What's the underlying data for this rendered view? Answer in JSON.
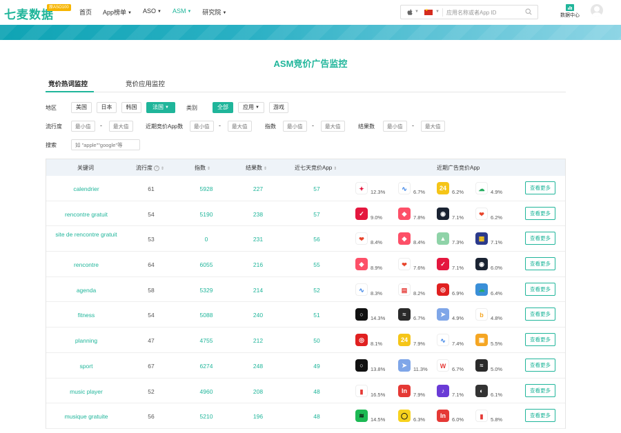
{
  "logo": {
    "text": "七麦数据",
    "badge": "原ASO100"
  },
  "nav": {
    "items": [
      {
        "label": "首页",
        "caret": false
      },
      {
        "label": "App榜单",
        "caret": true
      },
      {
        "label": "ASO",
        "caret": true
      },
      {
        "label": "ASM",
        "caret": true,
        "active": true
      },
      {
        "label": "研究院",
        "caret": true
      }
    ]
  },
  "search": {
    "placeholder": "应用名称或者App ID"
  },
  "header": {
    "data_center": "数据中心"
  },
  "page": {
    "title": "ASM竞价广告监控"
  },
  "tabs": [
    {
      "label": "竞价热词监控",
      "active": true
    },
    {
      "label": "竞价应用监控",
      "active": false
    }
  ],
  "filters": {
    "region_label": "地区",
    "regions": [
      "美国",
      "日本",
      "韩国",
      "法国"
    ],
    "region_selected": "法国",
    "category_label": "类别",
    "categories": [
      "全部",
      "应用",
      "游戏"
    ],
    "category_selected": "全部",
    "popularity_label": "流行度",
    "recent_label": "近期竞价App数",
    "index_label": "指数",
    "results_label": "结果数",
    "min_placeholder": "最小值",
    "max_placeholder": "最大值",
    "dash": "-",
    "search_label": "搜索",
    "search_placeholder": "如 \"apple\"\"google\"等"
  },
  "table": {
    "headers": {
      "keyword": "关键词",
      "popularity": "流行度",
      "index": "指数",
      "results": "结果数",
      "seven_day": "近七天竞价App",
      "recent_apps": "近期广告竞价App"
    },
    "more_label": "查看更多",
    "rows": [
      {
        "keyword": "calendrier",
        "popularity": "61",
        "index": "5928",
        "results": "227",
        "seven_day": "57",
        "apps": [
          {
            "icon": "mosaic-app-icon",
            "color": "#ffffff",
            "pct": "12.3%"
          },
          {
            "icon": "wave-app-icon",
            "color": "#ffffff",
            "pct": "6.7%"
          },
          {
            "icon": "calendar-24-app-icon",
            "color": "#f5c518",
            "pct": "6.2%"
          },
          {
            "icon": "cloud-app-icon",
            "color": "#ffffff",
            "pct": "4.9%"
          }
        ]
      },
      {
        "keyword": "rencontre gratuit",
        "popularity": "54",
        "index": "5190",
        "results": "238",
        "seven_day": "57",
        "apps": [
          {
            "icon": "red-check-app-icon",
            "color": "#e4173e",
            "pct": "9.0%"
          },
          {
            "icon": "tinder-app-icon",
            "color": "#fd5068",
            "pct": "7.8%"
          },
          {
            "icon": "profile-app-icon",
            "color": "#1a2332",
            "pct": "7.1%"
          },
          {
            "icon": "heart-app-icon",
            "color": "#ffffff",
            "pct": "6.2%"
          }
        ]
      },
      {
        "keyword": "site de rencontre gratuit",
        "popularity": "53",
        "index": "0",
        "results": "231",
        "seven_day": "56",
        "apps": [
          {
            "icon": "heart-app-icon",
            "color": "#ffffff",
            "pct": "8.4%"
          },
          {
            "icon": "tinder-app-icon",
            "color": "#fd5068",
            "pct": "8.4%"
          },
          {
            "icon": "landscape-app-icon",
            "color": "#8fd3a8",
            "pct": "7.3%"
          },
          {
            "icon": "puzzle-app-icon",
            "color": "#2b3a8c",
            "pct": "7.1%"
          }
        ]
      },
      {
        "keyword": "rencontre",
        "popularity": "64",
        "index": "6055",
        "results": "216",
        "seven_day": "55",
        "apps": [
          {
            "icon": "tinder-app-icon",
            "color": "#fd5068",
            "pct": "8.9%"
          },
          {
            "icon": "heart-app-icon",
            "color": "#ffffff",
            "pct": "7.6%"
          },
          {
            "icon": "red-check-app-icon",
            "color": "#e4173e",
            "pct": "7.1%"
          },
          {
            "icon": "profile-app-icon",
            "color": "#1a2332",
            "pct": "6.0%"
          }
        ]
      },
      {
        "keyword": "agenda",
        "popularity": "58",
        "index": "5329",
        "results": "214",
        "seven_day": "52",
        "apps": [
          {
            "icon": "wave-app-icon",
            "color": "#ffffff",
            "pct": "8.3%"
          },
          {
            "icon": "calendar-app-icon",
            "color": "#ffffff",
            "pct": "8.2%"
          },
          {
            "icon": "target-app-icon",
            "color": "#e02020",
            "pct": "6.9%"
          },
          {
            "icon": "cloud-app-icon",
            "color": "#3a8fd8",
            "pct": "6.4%"
          }
        ]
      },
      {
        "keyword": "fitness",
        "popularity": "54",
        "index": "5088",
        "results": "240",
        "seven_day": "51",
        "apps": [
          {
            "icon": "ring-app-icon",
            "color": "#111111",
            "pct": "14.3%"
          },
          {
            "icon": "gym-app-icon",
            "color": "#2a2a2a",
            "pct": "6.7%"
          },
          {
            "icon": "arrow-app-icon",
            "color": "#7fa6e8",
            "pct": "4.9%"
          },
          {
            "icon": "b-app-icon",
            "color": "#ffffff",
            "pct": "4.8%"
          }
        ]
      },
      {
        "keyword": "planning",
        "popularity": "47",
        "index": "4755",
        "results": "212",
        "seven_day": "50",
        "apps": [
          {
            "icon": "target-app-icon",
            "color": "#e02020",
            "pct": "8.1%"
          },
          {
            "icon": "calendar-24-app-icon",
            "color": "#f5c518",
            "pct": "7.9%"
          },
          {
            "icon": "wave-app-icon",
            "color": "#ffffff",
            "pct": "7.4%"
          },
          {
            "icon": "bag-app-icon",
            "color": "#f5a623",
            "pct": "5.5%"
          }
        ]
      },
      {
        "keyword": "sport",
        "popularity": "67",
        "index": "6274",
        "results": "248",
        "seven_day": "49",
        "apps": [
          {
            "icon": "ring-app-icon",
            "color": "#111111",
            "pct": "13.8%"
          },
          {
            "icon": "arrow-app-icon",
            "color": "#7fa6e8",
            "pct": "11.3%"
          },
          {
            "icon": "w-app-icon",
            "color": "#ffffff",
            "pct": "6.7%"
          },
          {
            "icon": "gym-app-icon",
            "color": "#2a2a2a",
            "pct": "5.0%"
          }
        ]
      },
      {
        "keyword": "music player",
        "popularity": "52",
        "index": "4960",
        "results": "208",
        "seven_day": "48",
        "apps": [
          {
            "icon": "equalizer-app-icon",
            "color": "#ffffff",
            "pct": "16.5%"
          },
          {
            "icon": "inr-app-icon",
            "color": "#e53935",
            "pct": "7.9%"
          },
          {
            "icon": "note-app-icon",
            "color": "#6a3bd6",
            "pct": "7.1%"
          },
          {
            "icon": "disc-app-icon",
            "color": "#333333",
            "pct": "6.1%"
          }
        ]
      },
      {
        "keyword": "musique gratuite",
        "popularity": "56",
        "index": "5210",
        "results": "196",
        "seven_day": "48",
        "apps": [
          {
            "icon": "spotify-app-icon",
            "color": "#1db954",
            "pct": "14.5%"
          },
          {
            "icon": "circle-app-icon",
            "color": "#f7d21e",
            "pct": "6.3%"
          },
          {
            "icon": "inr-app-icon",
            "color": "#e53935",
            "pct": "6.0%"
          },
          {
            "icon": "equalizer-app-icon",
            "color": "#ffffff",
            "pct": "5.8%"
          }
        ]
      }
    ]
  }
}
